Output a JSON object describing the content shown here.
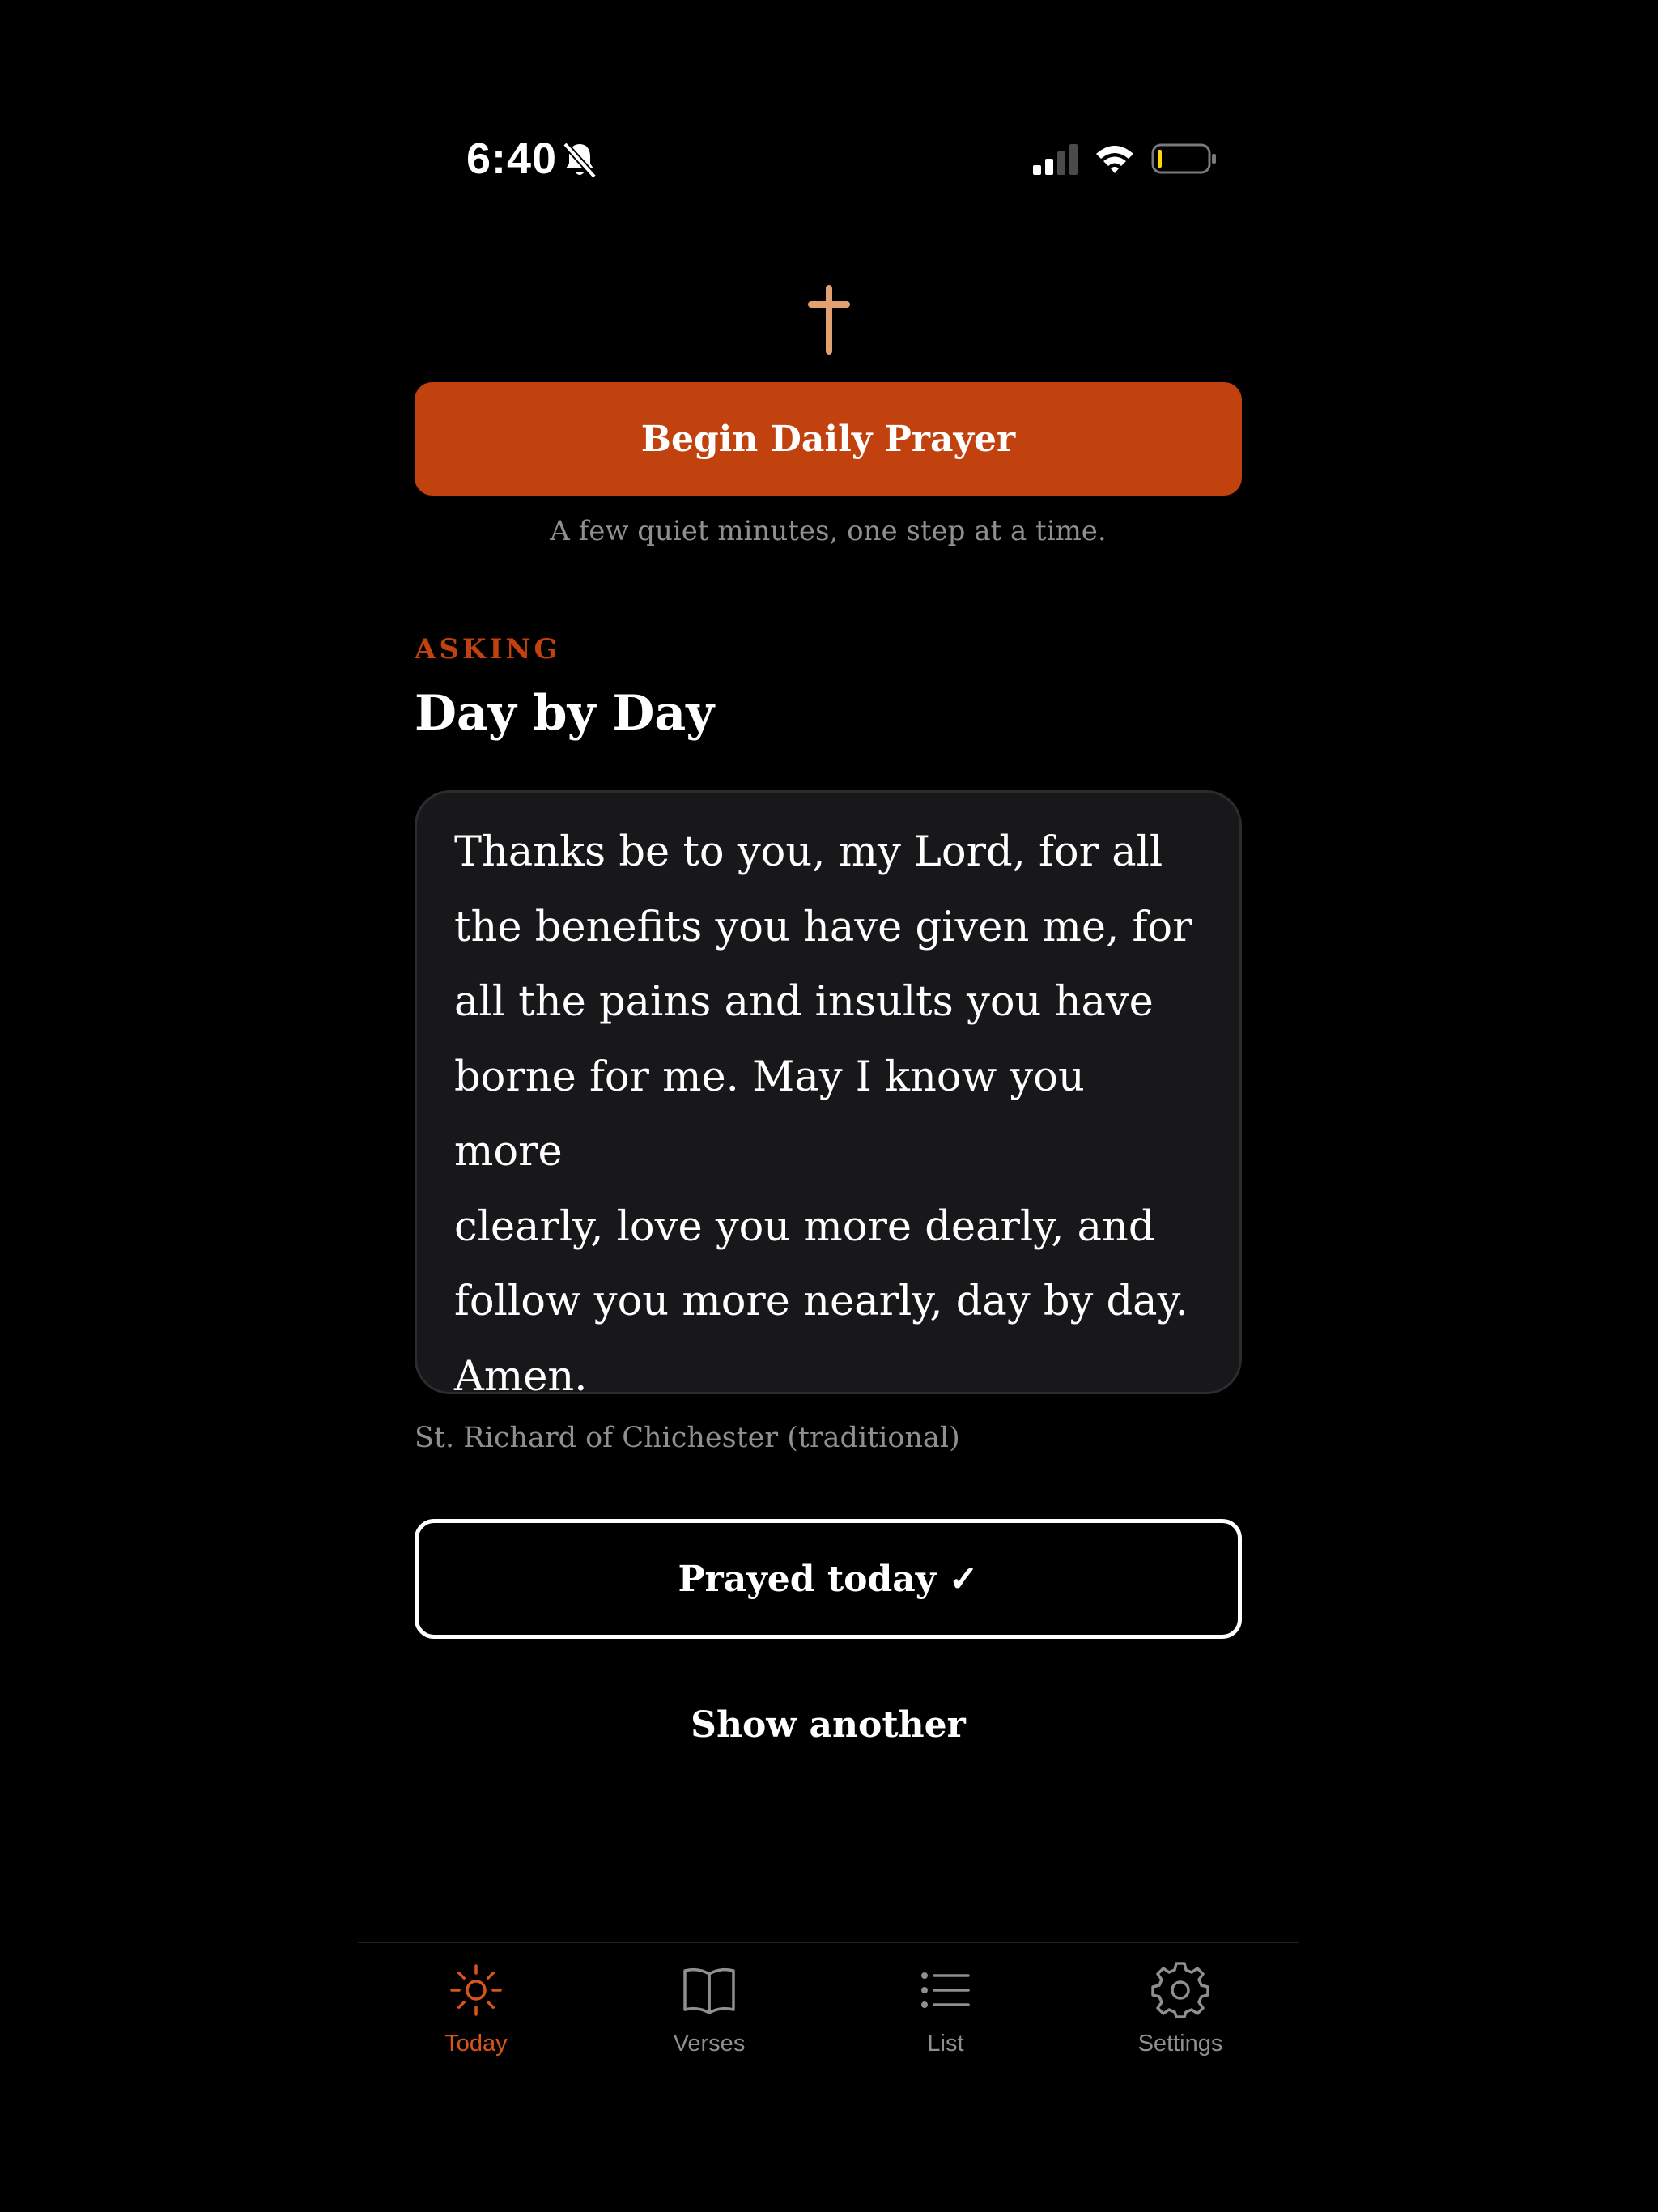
{
  "status_bar": {
    "time": "6:40"
  },
  "colors": {
    "accent": "#c1410f",
    "cross": "#e0a070",
    "card_bg": "#18181a",
    "muted_text": "#8e8e93"
  },
  "header": {
    "icon": "cross-icon"
  },
  "begin_button": {
    "label": "Begin Daily Prayer",
    "subtitle": "A few quiet minutes, one step at a time."
  },
  "prayer": {
    "category": "ASKING",
    "title": "Day by Day",
    "lines": [
      "Thanks be to you, my Lord, for all",
      "the benefits you have given me, for",
      "all the pains and insults you have",
      "borne for me. May I know you more",
      "clearly, love you more dearly, and",
      "follow you more nearly, day by day.",
      "Amen."
    ],
    "attribution": "St. Richard of Chichester (traditional)"
  },
  "actions": {
    "prayed_label": "Prayed today ✓",
    "show_another_label": "Show another"
  },
  "tab_bar": {
    "items": [
      {
        "label": "Today",
        "icon": "sun-icon",
        "active": true
      },
      {
        "label": "Verses",
        "icon": "book-icon",
        "active": false
      },
      {
        "label": "List",
        "icon": "list-icon",
        "active": false
      },
      {
        "label": "Settings",
        "icon": "gear-icon",
        "active": false
      }
    ]
  }
}
